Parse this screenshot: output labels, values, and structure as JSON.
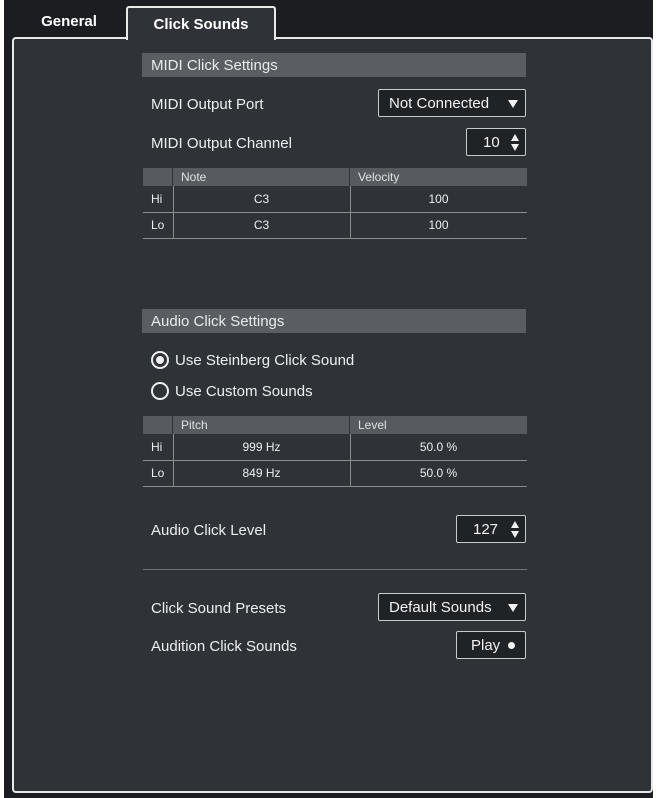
{
  "tabs": [
    {
      "label": "General",
      "active": false
    },
    {
      "label": "Click Sounds",
      "active": true
    }
  ],
  "midi": {
    "header": "MIDI Click Settings",
    "output_port_label": "MIDI Output Port",
    "output_port_value": "Not Connected",
    "output_channel_label": "MIDI Output Channel",
    "output_channel_value": "10",
    "table": {
      "columns": [
        "Note",
        "Velocity"
      ],
      "rows": [
        {
          "label": "Hi",
          "note": "C3",
          "velocity": "100"
        },
        {
          "label": "Lo",
          "note": "C3",
          "velocity": "100"
        }
      ]
    }
  },
  "audio": {
    "header": "Audio Click Settings",
    "radio_steinberg": "Use Steinberg Click Sound",
    "radio_custom": "Use Custom Sounds",
    "selected": "steinberg",
    "table": {
      "columns": [
        "Pitch",
        "Level"
      ],
      "rows": [
        {
          "label": "Hi",
          "pitch": "999 Hz",
          "level": "50.0 %"
        },
        {
          "label": "Lo",
          "pitch": "849 Hz",
          "level": "50.0 %"
        }
      ]
    },
    "click_level_label": "Audio Click Level",
    "click_level_value": "127"
  },
  "presets": {
    "label": "Click Sound Presets",
    "value": "Default Sounds",
    "audition_label": "Audition Click Sounds",
    "play_label": "Play"
  },
  "colors": {
    "window_bg": "#1b1d20",
    "panel_bg": "#2f3338",
    "section_header_bg": "#5a5e63",
    "field_bg": "#202326"
  }
}
